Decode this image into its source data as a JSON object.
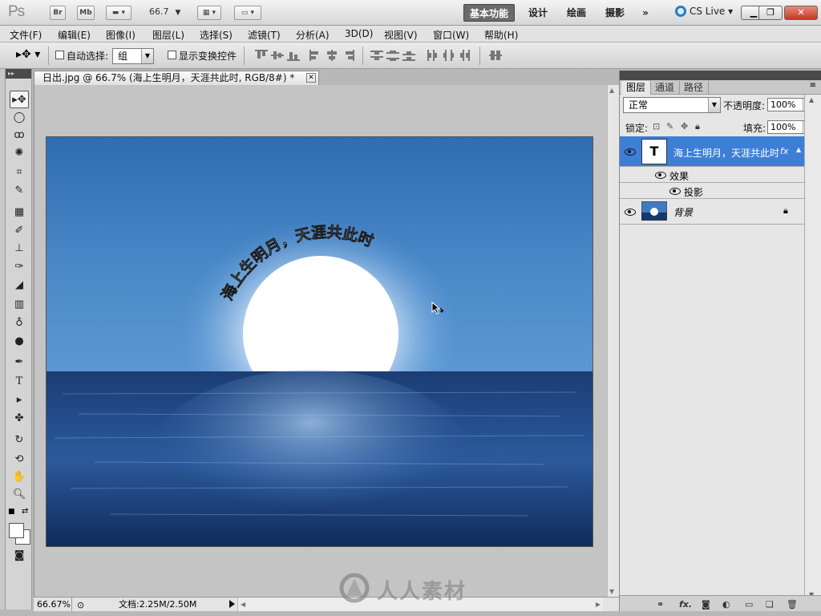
{
  "app": {
    "logo": "Ps",
    "bridge_label": "Br",
    "minibridge_label": "Mb",
    "zoom_value": "66.7",
    "workspaces": [
      "基本功能",
      "设计",
      "绘画",
      "摄影"
    ],
    "more_label": "»",
    "cs_live": "CS Live"
  },
  "menu": [
    "文件(F)",
    "编辑(E)",
    "图像(I)",
    "图层(L)",
    "选择(S)",
    "滤镜(T)",
    "分析(A)",
    "3D(D)",
    "视图(V)",
    "窗口(W)",
    "帮助(H)"
  ],
  "options": {
    "auto_select_label": "自动选择:",
    "auto_select_value": "组",
    "transform_label": "显示变换控件"
  },
  "document": {
    "tab_title": "日出.jpg @ 66.7% (海上生明月，天涯共此时, RGB/8#) *",
    "arc_text": "海上生明月，天涯共此时",
    "status_zoom": "66.67%",
    "status_docinfo": "文档:2.25M/2.50M"
  },
  "panel": {
    "tabs": [
      "图层",
      "通道",
      "路径"
    ],
    "blend_mode": "正常",
    "opacity_label": "不透明度:",
    "opacity_value": "100%",
    "lock_label": "锁定:",
    "fill_label": "填充:",
    "fill_value": "100%",
    "layers": [
      {
        "name": "海上生明月，天涯共此时",
        "fx": "fx"
      },
      {
        "name": "背景"
      }
    ],
    "effects_label": "效果",
    "drop_shadow_label": "投影"
  },
  "watermark": "人人素材",
  "colors": {
    "sky_top": "#2f6db2",
    "sky_mid": "#4f8fcf",
    "sea_dark": "#0d2a5a",
    "layer_selected": "#3d7fd6",
    "active_workspace": "#6a6a6a"
  }
}
